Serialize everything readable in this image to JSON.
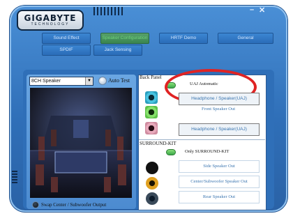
{
  "window": {
    "brand_main": "GIGABYTE",
    "brand_sub": "TECHNOLOGY",
    "minimize_label": "–",
    "close_label": "✕"
  },
  "tabs": [
    {
      "label": "Sound Effect",
      "active": false
    },
    {
      "label": "Speaker Configuration",
      "active": true
    },
    {
      "label": "HRTF Demo",
      "active": false
    },
    {
      "label": "General",
      "active": false
    },
    {
      "label": "SPDIF",
      "active": false
    },
    {
      "label": "Jack Sensing",
      "active": false
    }
  ],
  "left": {
    "speaker_select": "8CH Speaker",
    "auto_test_label": "Auto Test",
    "swap_label": "Swap Center / Subwoofer Output"
  },
  "right": {
    "back_panel_label": "Back Panel",
    "uaj_label": "UAJ Automatic",
    "back_outputs": [
      {
        "label": "Headphone / Speaker(UAJ)",
        "boxed": true,
        "jack_color": "#2a9fbf"
      },
      {
        "label": "Front Speaker Out",
        "boxed": false,
        "jack_color": "#5fc24a"
      },
      {
        "label": "Headphone / Speaker(UAJ)",
        "boxed": true,
        "jack_color": "#d08ca0"
      }
    ],
    "surround_kit_label": "SURROUND-KIT",
    "only_surround_label": "Only SURROUND-KIT",
    "kit_outputs": [
      {
        "label": "Side Speaker Out",
        "jack_color": "#222222"
      },
      {
        "label": "Center/Subwoofer Speaker Out",
        "jack_color": "#e0a020"
      },
      {
        "label": "Rear Speaker Out",
        "jack_color": "#2a2a2a"
      }
    ]
  },
  "colors": {
    "accent": "#2f6fb8",
    "highlight": "#e02323",
    "active_tab": "#6fd07a"
  }
}
